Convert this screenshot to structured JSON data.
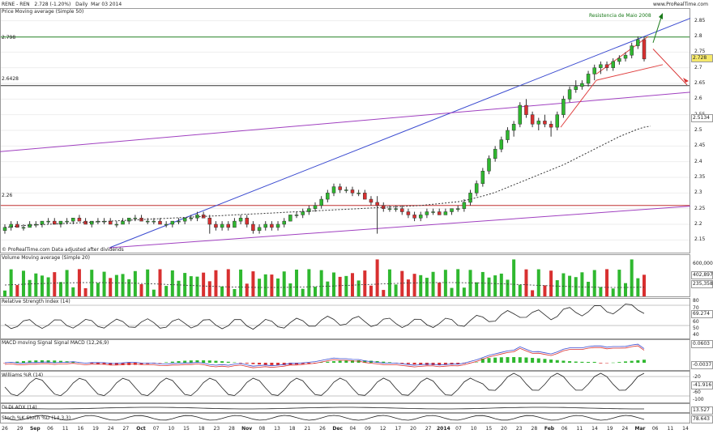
{
  "header": {
    "symbol": "RENE - REN",
    "last": "2.728 (-1.20%)",
    "period": "Daily",
    "date": "Mar 03 2014",
    "brand": "www.ProRealTime.com"
  },
  "panels": {
    "price": {
      "legend": "Price Moving average (Simple 50)",
      "footer": "© ProRealTime.com Data adjusted after dividends",
      "annotation": "Resistencia de Maio 2008",
      "y_ticks": [
        "2.85",
        "2.8",
        "2.75",
        "2.7",
        "2.65",
        "2.6",
        "2.55",
        "2.5",
        "2.45",
        "2.4",
        "2.35",
        "2.3",
        "2.25",
        "2.2",
        "2.15"
      ],
      "hlines": [
        "2.798",
        "2.6428",
        "2.26"
      ],
      "price_box": "2.728",
      "ma_box": "2.5134"
    },
    "volume": {
      "legend": "Volume Moving average (Simple 20)",
      "y_ticks": [
        "600,000",
        "400,000",
        "200,000"
      ],
      "boxes": [
        "402,897",
        "235,358"
      ]
    },
    "rsi": {
      "legend": "Relative Strength Index (14)",
      "y_ticks": [
        "80",
        "70",
        "60",
        "50",
        "40"
      ],
      "box": "69.274"
    },
    "macd": {
      "legend": "MACD moving Signal Signal MACD (12,26,9)",
      "boxes": [
        "0.0603",
        "-0.0037"
      ]
    },
    "williams": {
      "legend": "Williams %R (14)",
      "y_ticks": [
        "-20",
        "-40",
        "-60",
        "-80",
        "-100"
      ],
      "box": "-41.916"
    },
    "adx": {
      "legend": "DI  DI  ADX (14)",
      "box": "13.527"
    },
    "stoch": {
      "legend": "Stoch %K Stoch %D (14,3,3)",
      "box": "78.643"
    }
  },
  "x_axis": [
    "26",
    "29",
    "Sep",
    "06",
    "11",
    "16",
    "19",
    "24",
    "27",
    "Oct",
    "07",
    "10",
    "15",
    "18",
    "23",
    "28",
    "Nov",
    "08",
    "13",
    "18",
    "21",
    "26",
    "Dec",
    "04",
    "09",
    "12",
    "17",
    "20",
    "27",
    "2014",
    "07",
    "10",
    "15",
    "20",
    "23",
    "28",
    "Feb",
    "06",
    "11",
    "14",
    "19",
    "24",
    "Mar",
    "06",
    "11",
    "14"
  ],
  "chart_data": {
    "type": "candlestick",
    "title": "RENE - REN  2.728 (-1.20%)  Daily  Mar 03 2014",
    "ylim": [
      2.125,
      2.875
    ],
    "candles": [
      [
        2.18,
        2.2,
        2.17,
        2.19
      ],
      [
        2.19,
        2.21,
        2.18,
        2.2
      ],
      [
        2.2,
        2.21,
        2.19,
        2.19
      ],
      [
        2.19,
        2.2,
        2.18,
        2.19
      ],
      [
        2.19,
        2.21,
        2.19,
        2.2
      ],
      [
        2.2,
        2.21,
        2.19,
        2.2
      ],
      [
        2.2,
        2.21,
        2.19,
        2.21
      ],
      [
        2.21,
        2.22,
        2.2,
        2.21
      ],
      [
        2.21,
        2.22,
        2.2,
        2.2
      ],
      [
        2.2,
        2.21,
        2.19,
        2.21
      ],
      [
        2.21,
        2.22,
        2.2,
        2.21
      ],
      [
        2.21,
        2.22,
        2.2,
        2.22
      ],
      [
        2.22,
        2.23,
        2.21,
        2.21
      ],
      [
        2.21,
        2.22,
        2.2,
        2.2
      ],
      [
        2.2,
        2.21,
        2.19,
        2.21
      ],
      [
        2.21,
        2.22,
        2.2,
        2.21
      ],
      [
        2.21,
        2.22,
        2.2,
        2.21
      ],
      [
        2.21,
        2.22,
        2.2,
        2.2
      ],
      [
        2.2,
        2.21,
        2.19,
        2.2
      ],
      [
        2.2,
        2.22,
        2.2,
        2.21
      ],
      [
        2.21,
        2.22,
        2.2,
        2.22
      ],
      [
        2.22,
        2.23,
        2.21,
        2.22
      ],
      [
        2.22,
        2.23,
        2.21,
        2.21
      ],
      [
        2.21,
        2.22,
        2.2,
        2.21
      ],
      [
        2.21,
        2.22,
        2.2,
        2.21
      ],
      [
        2.21,
        2.22,
        2.2,
        2.2
      ],
      [
        2.2,
        2.21,
        2.19,
        2.2
      ],
      [
        2.2,
        2.21,
        2.19,
        2.21
      ],
      [
        2.21,
        2.22,
        2.2,
        2.21
      ],
      [
        2.21,
        2.22,
        2.2,
        2.22
      ],
      [
        2.22,
        2.23,
        2.21,
        2.22
      ],
      [
        2.22,
        2.24,
        2.21,
        2.23
      ],
      [
        2.23,
        2.24,
        2.22,
        2.22
      ],
      [
        2.22,
        2.23,
        2.17,
        2.2
      ],
      [
        2.2,
        2.21,
        2.18,
        2.19
      ],
      [
        2.19,
        2.21,
        2.18,
        2.2
      ],
      [
        2.2,
        2.21,
        2.18,
        2.19
      ],
      [
        2.19,
        2.22,
        2.19,
        2.21
      ],
      [
        2.21,
        2.23,
        2.2,
        2.22
      ],
      [
        2.22,
        2.23,
        2.19,
        2.2
      ],
      [
        2.2,
        2.21,
        2.17,
        2.18
      ],
      [
        2.18,
        2.2,
        2.17,
        2.19
      ],
      [
        2.19,
        2.21,
        2.18,
        2.2
      ],
      [
        2.2,
        2.21,
        2.18,
        2.19
      ],
      [
        2.19,
        2.21,
        2.18,
        2.2
      ],
      [
        2.2,
        2.22,
        2.19,
        2.21
      ],
      [
        2.21,
        2.23,
        2.21,
        2.23
      ],
      [
        2.23,
        2.24,
        2.22,
        2.23
      ],
      [
        2.23,
        2.25,
        2.22,
        2.24
      ],
      [
        2.24,
        2.26,
        2.23,
        2.25
      ],
      [
        2.25,
        2.27,
        2.24,
        2.26
      ],
      [
        2.26,
        2.29,
        2.25,
        2.28
      ],
      [
        2.28,
        2.31,
        2.27,
        2.3
      ],
      [
        2.3,
        2.33,
        2.29,
        2.32
      ],
      [
        2.32,
        2.33,
        2.3,
        2.31
      ],
      [
        2.31,
        2.32,
        2.3,
        2.31
      ],
      [
        2.31,
        2.32,
        2.29,
        2.3
      ],
      [
        2.3,
        2.31,
        2.29,
        2.3
      ],
      [
        2.3,
        2.31,
        2.28,
        2.28
      ],
      [
        2.28,
        2.29,
        2.26,
        2.27
      ],
      [
        2.27,
        2.29,
        2.17,
        2.26
      ],
      [
        2.26,
        2.27,
        2.24,
        2.25
      ],
      [
        2.25,
        2.26,
        2.24,
        2.25
      ],
      [
        2.25,
        2.26,
        2.24,
        2.25
      ],
      [
        2.25,
        2.26,
        2.23,
        2.24
      ],
      [
        2.24,
        2.25,
        2.22,
        2.23
      ],
      [
        2.23,
        2.24,
        2.21,
        2.22
      ],
      [
        2.22,
        2.24,
        2.21,
        2.23
      ],
      [
        2.23,
        2.25,
        2.22,
        2.24
      ],
      [
        2.24,
        2.25,
        2.23,
        2.24
      ],
      [
        2.24,
        2.25,
        2.23,
        2.23
      ],
      [
        2.23,
        2.25,
        2.23,
        2.24
      ],
      [
        2.24,
        2.25,
        2.23,
        2.25
      ],
      [
        2.25,
        2.26,
        2.24,
        2.25
      ],
      [
        2.25,
        2.28,
        2.24,
        2.27
      ],
      [
        2.27,
        2.31,
        2.26,
        2.3
      ],
      [
        2.3,
        2.34,
        2.29,
        2.33
      ],
      [
        2.33,
        2.38,
        2.32,
        2.37
      ],
      [
        2.37,
        2.42,
        2.36,
        2.41
      ],
      [
        2.41,
        2.45,
        2.4,
        2.44
      ],
      [
        2.44,
        2.48,
        2.43,
        2.47
      ],
      [
        2.47,
        2.51,
        2.46,
        2.5
      ],
      [
        2.5,
        2.53,
        2.48,
        2.52
      ],
      [
        2.52,
        2.59,
        2.51,
        2.58
      ],
      [
        2.58,
        2.6,
        2.54,
        2.55
      ],
      [
        2.55,
        2.56,
        2.51,
        2.52
      ],
      [
        2.52,
        2.54,
        2.5,
        2.53
      ],
      [
        2.53,
        2.55,
        2.51,
        2.52
      ],
      [
        2.52,
        2.53,
        2.48,
        2.51
      ],
      [
        2.51,
        2.56,
        2.5,
        2.55
      ],
      [
        2.55,
        2.61,
        2.54,
        2.6
      ],
      [
        2.6,
        2.64,
        2.59,
        2.63
      ],
      [
        2.63,
        2.66,
        2.62,
        2.64
      ],
      [
        2.64,
        2.66,
        2.63,
        2.65
      ],
      [
        2.65,
        2.69,
        2.64,
        2.68
      ],
      [
        2.68,
        2.71,
        2.66,
        2.7
      ],
      [
        2.7,
        2.72,
        2.68,
        2.71
      ],
      [
        2.71,
        2.72,
        2.69,
        2.7
      ],
      [
        2.7,
        2.73,
        2.69,
        2.72
      ],
      [
        2.72,
        2.74,
        2.71,
        2.73
      ],
      [
        2.73,
        2.75,
        2.72,
        2.74
      ],
      [
        2.74,
        2.78,
        2.73,
        2.77
      ],
      [
        2.77,
        2.8,
        2.76,
        2.79
      ],
      [
        2.79,
        2.8,
        2.72,
        2.728
      ]
    ],
    "ma50": [
      2.19,
      2.192,
      2.194,
      2.196,
      2.197,
      2.198,
      2.199,
      2.2,
      2.201,
      2.202,
      2.203,
      2.204,
      2.205,
      2.206,
      2.207,
      2.208,
      2.209,
      2.21,
      2.211,
      2.212,
      2.213,
      2.214,
      2.215,
      2.216,
      2.217,
      2.218,
      2.219,
      2.22,
      2.221,
      2.222,
      2.223,
      2.224,
      2.225,
      2.226,
      2.227,
      2.228,
      2.229,
      2.23,
      2.231,
      2.232,
      2.233,
      2.234,
      2.235,
      2.236,
      2.237,
      2.238,
      2.239,
      2.24,
      2.241,
      2.242,
      2.243,
      2.244,
      2.245,
      2.246,
      2.247,
      2.248,
      2.249,
      2.25,
      2.251,
      2.252,
      2.253,
      2.254,
      2.255,
      2.256,
      2.257,
      2.258,
      2.259,
      2.26,
      2.262,
      2.264,
      2.266,
      2.268,
      2.27,
      2.272,
      2.276,
      2.28,
      2.285,
      2.29,
      2.296,
      2.302,
      2.31,
      2.318,
      2.326,
      2.334,
      2.342,
      2.35,
      2.358,
      2.366,
      2.374,
      2.382,
      2.39,
      2.4,
      2.41,
      2.42,
      2.43,
      2.44,
      2.45,
      2.46,
      2.47,
      2.48,
      2.488,
      2.496,
      2.504,
      2.51,
      2.5134
    ]
  }
}
